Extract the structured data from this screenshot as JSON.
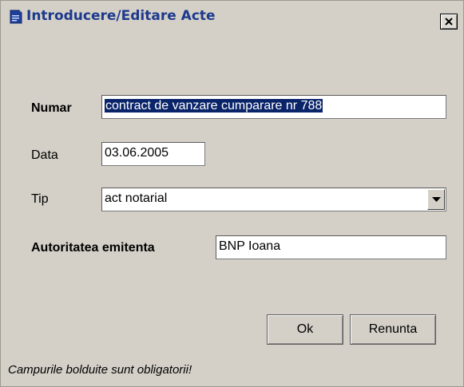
{
  "window": {
    "title": "Introducere/Editare Acte",
    "close_label": "X"
  },
  "form": {
    "numar": {
      "label": "Numar",
      "value": "contract de vanzare cumparare nr 788"
    },
    "data": {
      "label": "Data",
      "value": "03.06.2005"
    },
    "tip": {
      "label": "Tip",
      "selected": "act notarial"
    },
    "autoritate": {
      "label": "Autoritatea emitenta",
      "value": "BNP Ioana"
    }
  },
  "buttons": {
    "ok": "Ok",
    "cancel": "Renunta"
  },
  "footer_note": "Campurile bolduite sunt obligatorii!",
  "icons": {
    "app": "document-icon",
    "close": "close-icon",
    "dropdown": "chevron-down-icon"
  },
  "colors": {
    "title_text": "#1d3a8c",
    "window_bg": "#d4d0c8",
    "selection": "#0a246a"
  }
}
